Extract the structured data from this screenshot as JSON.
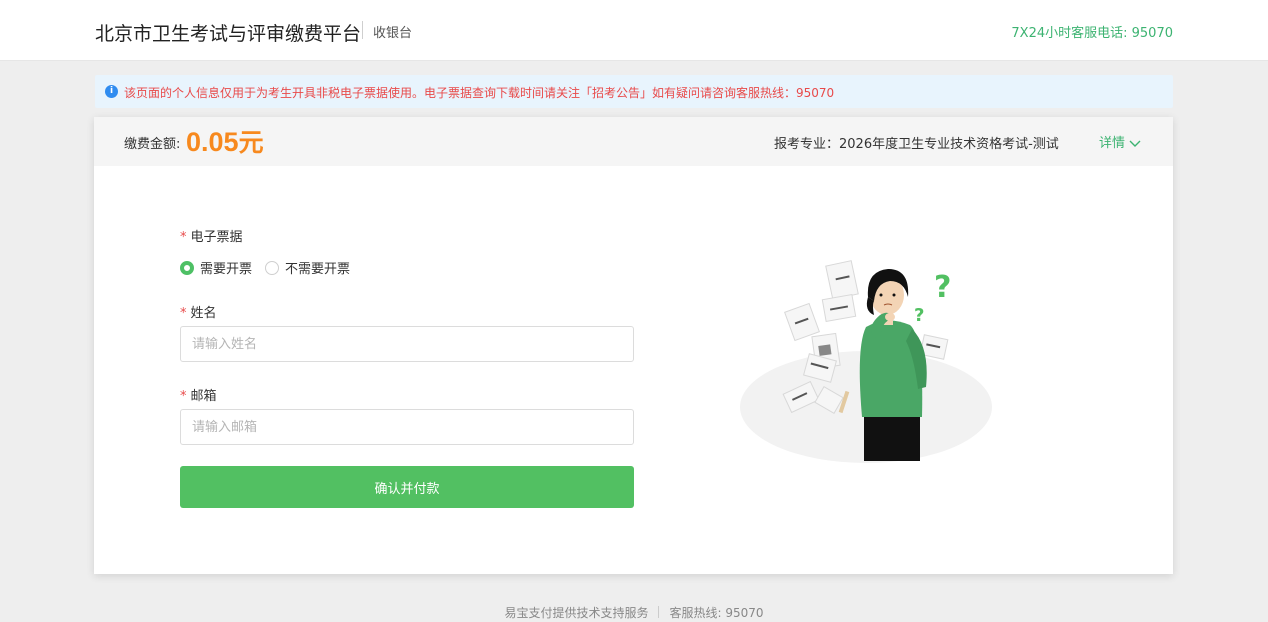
{
  "header": {
    "title": "北京市卫生考试与评审缴费平台",
    "subtitle": "收银台",
    "hotline": "7X24小时客服电话: 95070"
  },
  "notice": {
    "text": "该页面的个人信息仅用于为考生开具非税电子票据使用。电子票据查询下载时间请关注「招考公告」如有疑问请咨询客服热线：95070"
  },
  "payment": {
    "amount_label": "缴费金额:",
    "amount": "0.05",
    "unit": "元",
    "major": "报考专业：2026年度卫生专业技术资格考试-测试",
    "detail_label": "详情"
  },
  "form": {
    "invoice_label": "电子票据",
    "invoice_options": [
      "需要开票",
      "不需要开票"
    ],
    "invoice_selected": "需要开票",
    "name_label": "姓名",
    "name_placeholder": "请输入姓名",
    "email_label": "邮箱",
    "email_placeholder": "请输入邮箱",
    "submit_label": "确认并付款",
    "required_mark": "*"
  },
  "footer": {
    "provider": "易宝支付提供技术支持服务",
    "hotline": "客服热线: 95070"
  },
  "colors": {
    "accent_green": "#52c062",
    "amount_orange": "#f7891e",
    "notice_red": "#e84a4a",
    "notice_bg": "#e8f4fd"
  },
  "icons": [
    "info-icon",
    "chevron-down-icon"
  ]
}
